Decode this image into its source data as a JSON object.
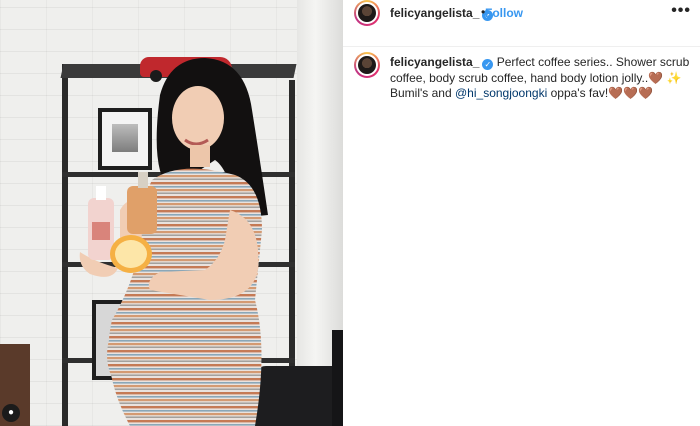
{
  "post": {
    "username": "felicyangelista_",
    "verified_icon": "verified-badge-icon",
    "dot": "•",
    "follow_label": "Follow",
    "more_label": "•••"
  },
  "caption": {
    "username": "felicyangelista_",
    "text_part1": "Perfect coffee series.. Shower scrub coffee, body scrub coffee, hand body lotion jolly..",
    "emoji_heart": "🤎",
    "emoji_sparkle": "✨",
    "text_part2": "Bumil's and",
    "mention": "@hi_songjoongki",
    "text_part3": "oppa's fav!",
    "emoji_hearts_end": "🤎🤎🤎"
  },
  "colors": {
    "accent": "#3897f0",
    "mention": "#00376b"
  }
}
